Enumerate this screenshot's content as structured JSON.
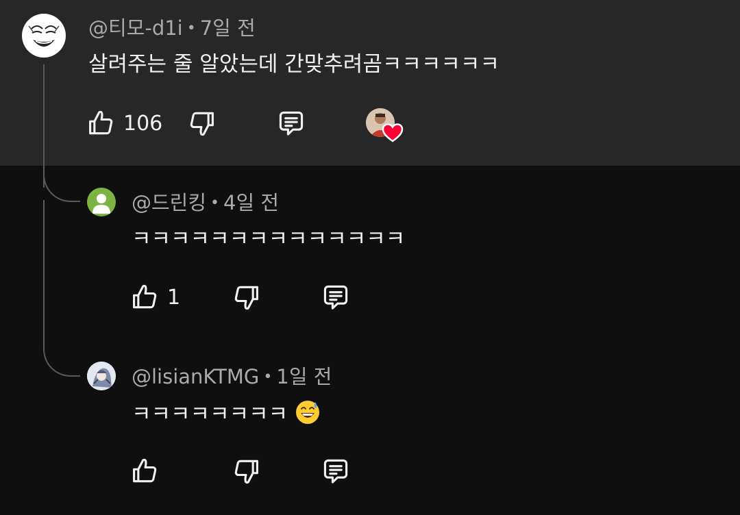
{
  "colors": {
    "top_background": "#272727",
    "page_background": "#0f0f0f",
    "text_primary": "#f1f1f1",
    "text_secondary": "#aaaaaa",
    "thread_line": "#5a5a5a",
    "heart": "#ff0033",
    "default_avatar": "#7cb342"
  },
  "comments": [
    {
      "handle": "@티모-d1i",
      "separator": "•",
      "time": "7일 전",
      "text": "살려주는 줄 알았는데 간맞추려곰ㅋㅋㅋㅋㅋㅋ",
      "like_count": "106",
      "creator_hearted": true,
      "avatar": "meme-face-avatar",
      "icons": [
        "like-icon",
        "dislike-icon",
        "reply-icon",
        "creator-heart-badge"
      ]
    },
    {
      "handle": "@드린킹",
      "separator": "•",
      "time": "4일 전",
      "text": "ㅋㅋㅋㅋㅋㅋㅋㅋㅋㅋㅋㅋㅋㅋ",
      "like_count": "1",
      "avatar": "default-person-avatar",
      "icons": [
        "like-icon",
        "dislike-icon",
        "reply-icon"
      ]
    },
    {
      "handle": "@lisianKTMG",
      "separator": "•",
      "time": "1일 전",
      "text": "ㅋㅋㅋㅋㅋㅋㅋㅋ",
      "emoji": "grinning-sweat-emoji",
      "avatar": "anime-character-avatar",
      "icons": [
        "like-icon",
        "dislike-icon",
        "reply-icon"
      ]
    }
  ]
}
